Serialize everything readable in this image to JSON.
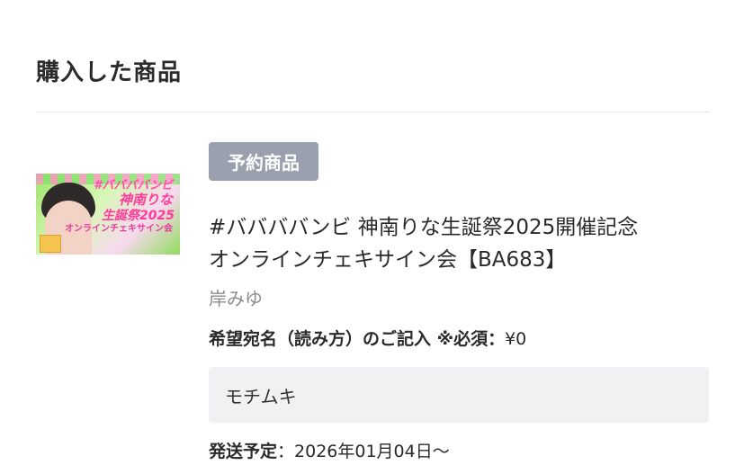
{
  "section": {
    "title": "購入した商品"
  },
  "product": {
    "badge": "予約商品",
    "title_line1": "#ババババンビ 神南りな生誕祭2025開催記念",
    "title_line2": "オンラインチェキサイン会【BA683】",
    "seller": "岸みゆ",
    "image_text": {
      "line1": "#ババババンビ",
      "line2": "神南りな",
      "line3": "生誕祭2025",
      "line4": "オンラインチェキサイン会"
    }
  },
  "form": {
    "field_label": "希望宛名（読み方）のご記入 ※必須：",
    "field_price": "¥0",
    "field_value": "モチムキ"
  },
  "shipping": {
    "label": "発送予定",
    "separator": "：",
    "value": "2026年01月04日〜"
  },
  "colors": {
    "badge_bg": "#9aa0ad",
    "input_bg": "#f1f1f3",
    "divider": "#e3e3e3"
  }
}
